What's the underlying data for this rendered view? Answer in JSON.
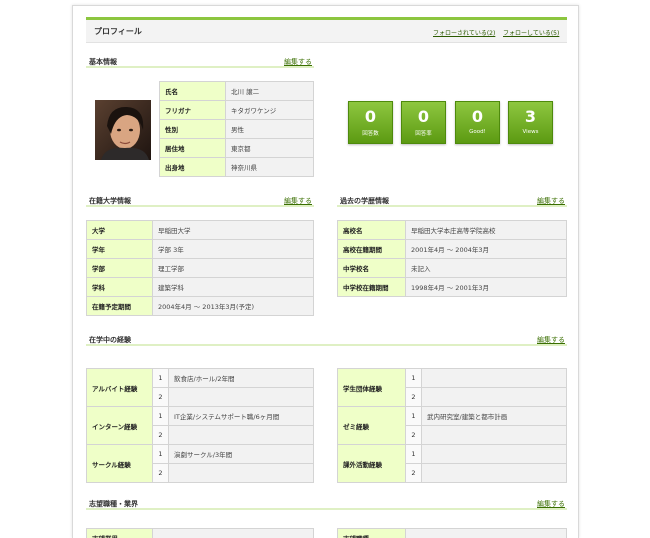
{
  "header": {
    "title": "プロフィール",
    "followers_link": "フォローされている(2)",
    "following_link": "フォローしている(5)"
  },
  "basic_info": {
    "title": "基本情報",
    "edit": "編集する",
    "rows": [
      {
        "label": "氏名",
        "value": "北川 譲二"
      },
      {
        "label": "フリガナ",
        "value": "キタガワケンジ"
      },
      {
        "label": "性別",
        "value": "男性"
      },
      {
        "label": "居住地",
        "value": "東京都"
      },
      {
        "label": "出身地",
        "value": "神奈川県"
      }
    ]
  },
  "stats": [
    {
      "value": "0",
      "label": "回答数"
    },
    {
      "value": "0",
      "label": "回答率"
    },
    {
      "value": "0",
      "label": "Good!"
    },
    {
      "value": "3",
      "label": "Views"
    }
  ],
  "university": {
    "title": "在籍大学情報",
    "edit": "編集する",
    "rows": [
      {
        "label": "大学",
        "value": "早稲田大学"
      },
      {
        "label": "学年",
        "value": "学部 3年"
      },
      {
        "label": "学部",
        "value": "理工学部"
      },
      {
        "label": "学科",
        "value": "建築学科"
      },
      {
        "label": "在籍予定期間",
        "value": "2004年4月 〜 2013年3月(予定)"
      }
    ]
  },
  "past_education": {
    "title": "過去の学歴情報",
    "edit": "編集する",
    "rows": [
      {
        "label": "高校名",
        "value": "早稲田大学本庄高等学院高校"
      },
      {
        "label": "高校在籍期間",
        "value": "2001年4月 〜 2004年3月"
      },
      {
        "label": "中学校名",
        "value": "未記入"
      },
      {
        "label": "中学校在籍期間",
        "value": "1998年4月 〜 2001年3月"
      }
    ]
  },
  "experience": {
    "title": "在学中の経験",
    "edit": "編集する",
    "left": [
      {
        "label": "アルバイト経験",
        "items": [
          {
            "n": "1",
            "text": "飲食店/ホール/2年間"
          },
          {
            "n": "2",
            "text": ""
          }
        ]
      },
      {
        "label": "インターン経験",
        "items": [
          {
            "n": "1",
            "text": "IT企業/システムサポート職/6ヶ月間"
          },
          {
            "n": "2",
            "text": ""
          }
        ]
      },
      {
        "label": "サークル経験",
        "items": [
          {
            "n": "1",
            "text": "演劇サークル/3年間"
          },
          {
            "n": "2",
            "text": ""
          }
        ]
      }
    ],
    "right": [
      {
        "label": "学生団体経験",
        "items": [
          {
            "n": "1",
            "text": ""
          },
          {
            "n": "2",
            "text": ""
          }
        ]
      },
      {
        "label": "ゼミ経験",
        "items": [
          {
            "n": "1",
            "text": "武内研究室/建築と都市計画"
          },
          {
            "n": "2",
            "text": ""
          }
        ]
      },
      {
        "label": "課外活動経験",
        "items": [
          {
            "n": "1",
            "text": ""
          },
          {
            "n": "2",
            "text": ""
          }
        ]
      }
    ]
  },
  "desired": {
    "title": "志望職種・業界",
    "edit": "編集する",
    "left_row": "志望業界",
    "right_row": "志望職種"
  }
}
